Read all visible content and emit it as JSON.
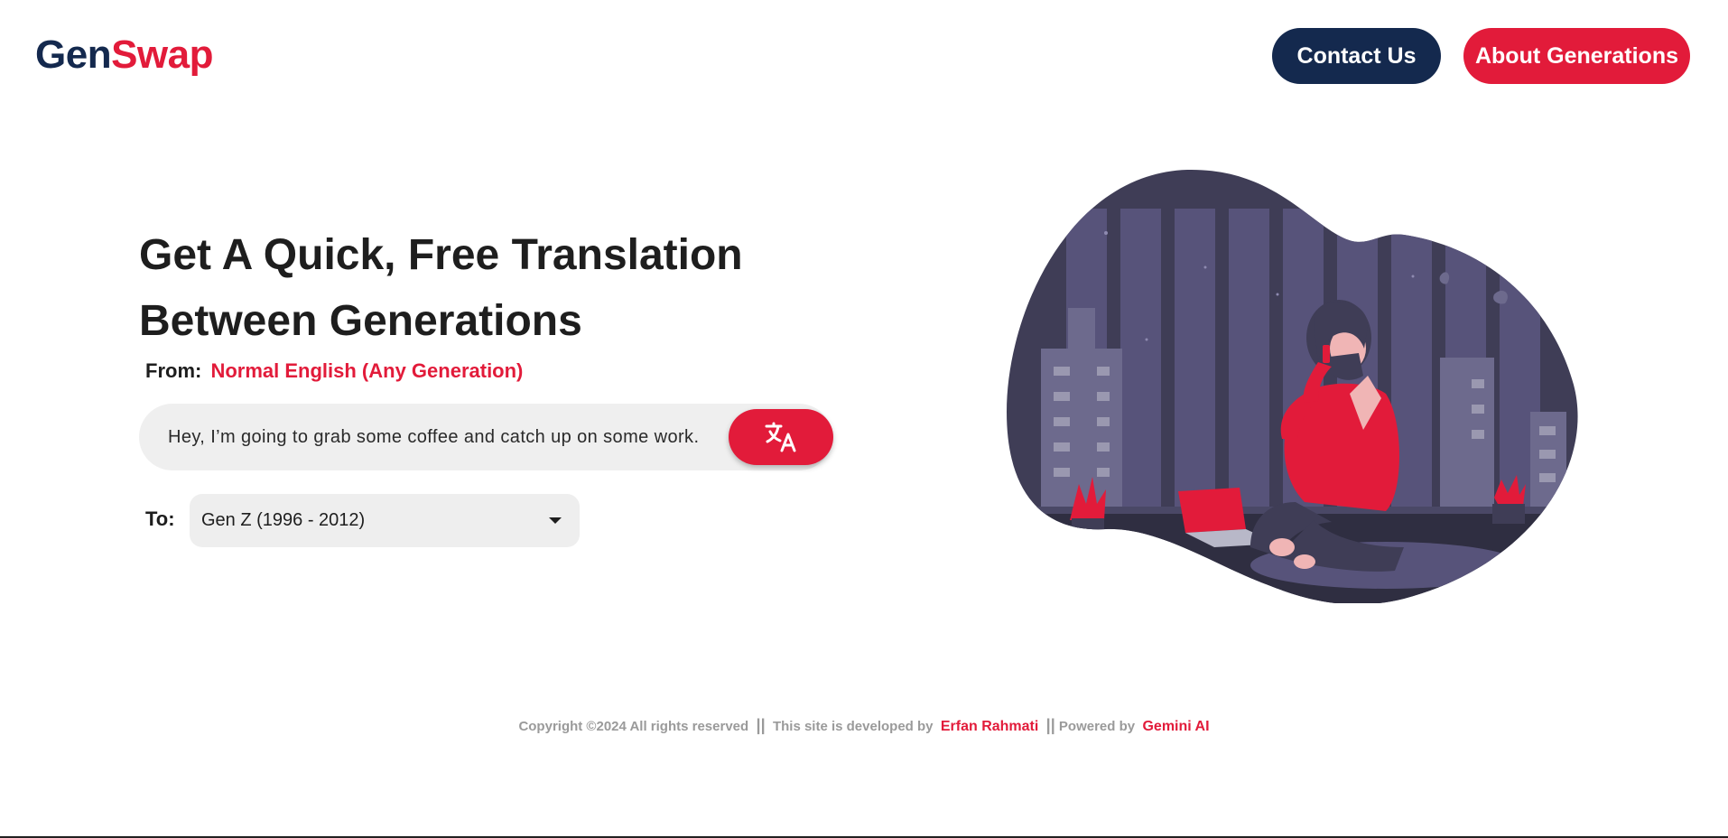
{
  "brand": {
    "part1": "Gen",
    "part2": "Swap"
  },
  "nav": {
    "contact_label": "Contact Us",
    "about_label": "About Generations"
  },
  "hero": {
    "headline_line1": "Get A Quick, Free Translation",
    "headline_line2": "Between Generations"
  },
  "translator": {
    "from_label": "From:",
    "from_value": "Normal English (Any Generation)",
    "input_value": "Hey, I’m going to grab some coffee and catch up on some work.",
    "translate_button_icon": "translate-icon",
    "to_label": "To:",
    "to_selected": "Gen Z (1996 - 2012)"
  },
  "footer": {
    "copyright": "Copyright ©2024 All rights reserved",
    "separator": "||",
    "developed_by": "This site is developed by",
    "developer_name": "Erfan Rahmati",
    "powered_by": "Powered by",
    "powered_name": "Gemini AI"
  },
  "colors": {
    "navy": "#14294e",
    "accent": "#e21b3a",
    "illustration_bg": "#3f3d56",
    "input_bg": "#efefef"
  }
}
